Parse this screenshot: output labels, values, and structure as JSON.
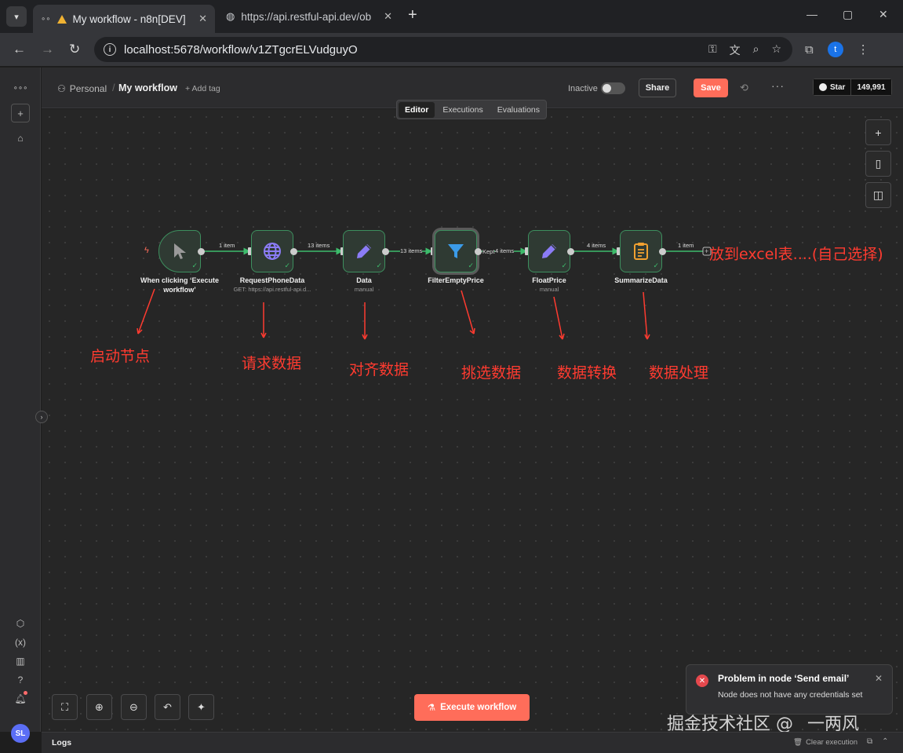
{
  "browser": {
    "tabs": [
      {
        "title": "My workflow - n8n[DEV]",
        "active": true
      },
      {
        "title": "https://api.restful-api.dev/ob",
        "active": false
      }
    ],
    "url": "localhost:5678/workflow/v1ZTgcrELVudguyO",
    "profile_initial": "t"
  },
  "header": {
    "project": "Personal",
    "workflow_name": "My workflow",
    "add_tag": "+ Add tag",
    "status_label": "Inactive",
    "share_label": "Share",
    "save_label": "Save",
    "github": {
      "star_label": "Star",
      "count": "149,991"
    }
  },
  "view_tabs": [
    "Editor",
    "Executions",
    "Evaluations"
  ],
  "nodes": [
    {
      "title": "When clicking ‘Execute workflow’",
      "subtitle": "",
      "icon": "cursor-icon",
      "color": "#9a9a9a"
    },
    {
      "title": "RequestPhoneData",
      "subtitle": "GET: https://api.restful-api.d...",
      "icon": "globe-icon",
      "color": "#8b7cf6"
    },
    {
      "title": "Data",
      "subtitle": "manual",
      "icon": "pencil-icon",
      "color": "#8b7cf6"
    },
    {
      "title": "FilterEmptyPrice",
      "subtitle": "",
      "icon": "filter-icon",
      "color": "#3b9be8"
    },
    {
      "title": "FloatPrice",
      "subtitle": "manual",
      "icon": "pencil-icon",
      "color": "#8b7cf6"
    },
    {
      "title": "SummarizeData",
      "subtitle": "",
      "icon": "clipboard-icon",
      "color": "#f0a030"
    }
  ],
  "edges": [
    {
      "label": "1 item"
    },
    {
      "label": "13 items"
    },
    {
      "label": "13 items"
    },
    {
      "label": "Kept"
    },
    {
      "label": "4 items"
    },
    {
      "label": "4 items"
    },
    {
      "label": "1 item"
    }
  ],
  "annotations": {
    "next": "放到excel表....(自己选择)",
    "labels": [
      "启动节点",
      "请求数据",
      "对齐数据",
      "挑选数据",
      "数据转换",
      "数据处理"
    ]
  },
  "execute_label": "Execute workflow",
  "toast": {
    "title": "Problem in node ‘Send email’",
    "message": "Node does not have any credentials set"
  },
  "watermark": "掘金技术社区 @ _一两风",
  "logs": {
    "label": "Logs",
    "clear": "Clear execution"
  },
  "rail": {
    "avatar_initials": "SL"
  },
  "colors": {
    "accent": "#ff6d5a",
    "node_border": "#3d8f5e",
    "success": "#3dbb6b",
    "annotation": "#ff3b30"
  }
}
